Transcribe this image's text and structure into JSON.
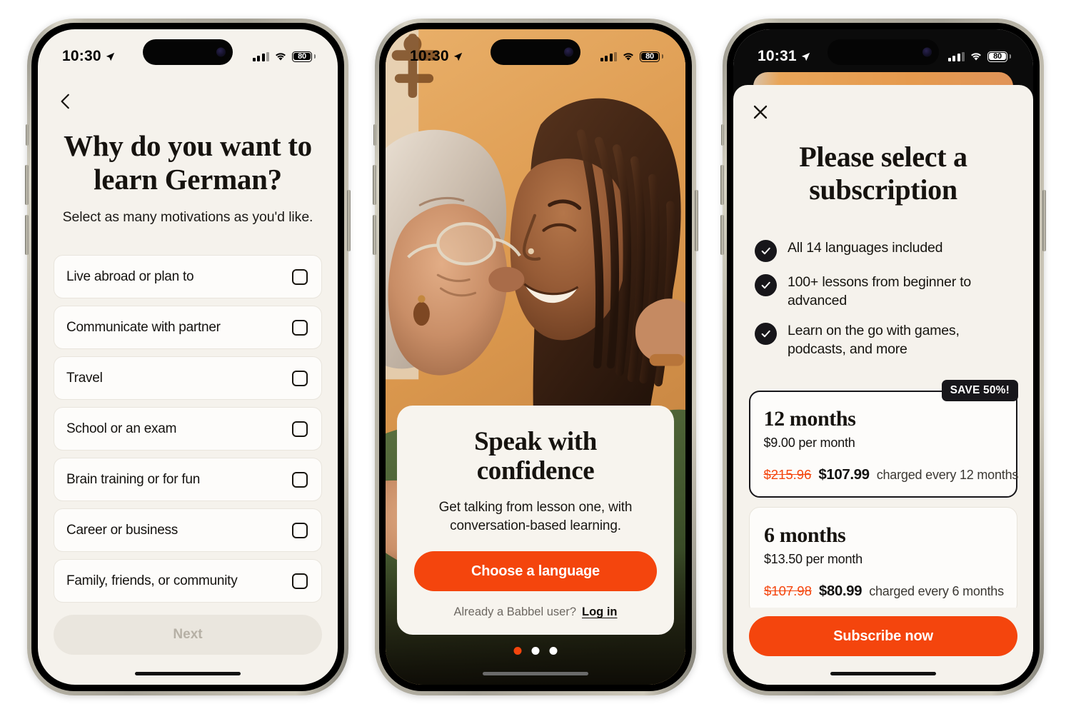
{
  "screens": [
    {
      "id": "motivations",
      "status": {
        "time": "10:30",
        "battery": "80",
        "theme": "dark"
      },
      "back_label": "Back",
      "title": "Why do you want to learn German?",
      "subtitle": "Select as many motivations as you'd like.",
      "options": [
        {
          "label": "Live abroad or plan to",
          "checked": false
        },
        {
          "label": "Communicate with partner",
          "checked": false
        },
        {
          "label": "Travel",
          "checked": false
        },
        {
          "label": "School or an exam",
          "checked": false
        },
        {
          "label": "Brain training or for fun",
          "checked": false
        },
        {
          "label": "Career or business",
          "checked": false
        },
        {
          "label": "Family, friends, or community",
          "checked": false
        }
      ],
      "next_label": "Next"
    },
    {
      "id": "hero",
      "status": {
        "time": "10:30",
        "battery": "80",
        "theme": "dark"
      },
      "photo_alt": "Older woman with gray hair kissing the cheek of a smiling young woman with long braids, both in green tops, against a warm ochre wall",
      "title": "Speak with confidence",
      "subtitle": "Get talking from lesson one, with conversation-based learning.",
      "cta_label": "Choose a language",
      "login_prompt": "Already a Babbel user?",
      "login_link": "Log in",
      "pager": {
        "count": 3,
        "active_index": 0
      }
    },
    {
      "id": "paywall",
      "status": {
        "time": "10:31",
        "battery": "80",
        "theme": "light"
      },
      "close_label": "Close",
      "title": "Please select a subscription",
      "benefits": [
        "All 14 languages included",
        "100+ lessons from beginner to advanced",
        "Learn on the go with games, podcasts, and more"
      ],
      "plans": [
        {
          "name": "12 months",
          "per_month": "$9.00 per month",
          "price_old": "$215.96",
          "price_new": "$107.99",
          "price_note": "charged every 12 months",
          "badge": "SAVE 50%!",
          "selected": true
        },
        {
          "name": "6 months",
          "per_month": "$13.50 per month",
          "price_old": "$107.98",
          "price_new": "$80.99",
          "price_note": "charged every 6 months",
          "badge": "",
          "selected": false
        }
      ],
      "subscribe_label": "Subscribe now"
    }
  ],
  "colors": {
    "accent_orange": "#f4450d",
    "page_bg": "#f5f2ec",
    "card_bg": "#fdfcfa",
    "ink": "#16130f",
    "disabled_bg": "#eae6de",
    "disabled_text": "#b6b0a5",
    "badge_bg": "#18171b"
  },
  "icons": {
    "back": "chevron-left-icon",
    "close": "close-icon",
    "check": "check-icon",
    "location": "location-arrow-icon",
    "cellular": "cellular-bars-icon",
    "wifi": "wifi-icon",
    "battery": "battery-icon"
  }
}
